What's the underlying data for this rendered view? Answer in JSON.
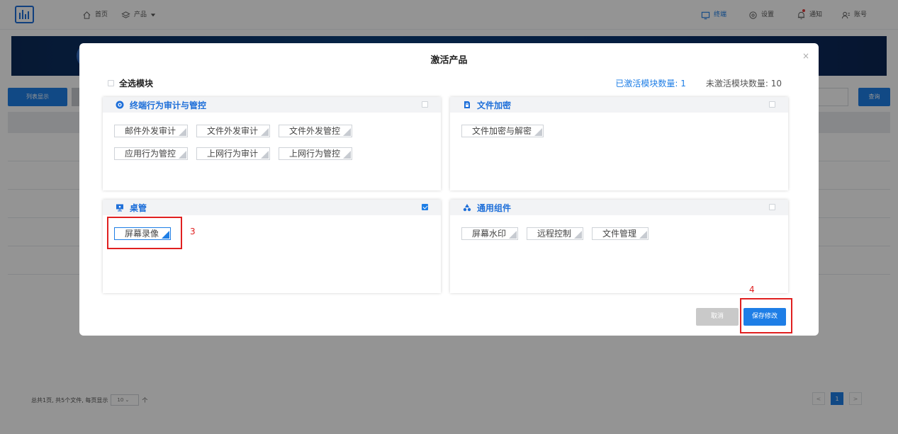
{
  "topbar": {
    "nav": [
      {
        "label": "首页",
        "icon": "home-icon"
      },
      {
        "label": "产品",
        "icon": "layers-icon"
      }
    ],
    "right": [
      {
        "label": "终端",
        "icon": "monitor-icon",
        "active": true
      },
      {
        "label": "设置",
        "icon": "settings-icon"
      },
      {
        "label": "通知",
        "icon": "bell-icon"
      },
      {
        "label": "账号",
        "icon": "user-icon"
      }
    ]
  },
  "background": {
    "list_button": "列表显示",
    "query_button": "查询",
    "pager": {
      "summary": "总共1页, 共5个文件, 每页显示",
      "page_size": "10",
      "unit": "个",
      "current_page": "1",
      "prev": "<",
      "next": ">"
    }
  },
  "modal": {
    "title": "激活产品",
    "close": "×",
    "select_all_label": "全选模块",
    "activated_count_label": "已激活模块数量: 1",
    "inactive_count_label": "未激活模块数量: 10",
    "panels": [
      {
        "title": "终端行为审计与管控",
        "icon": "gear-badge-icon",
        "checked": false,
        "modules": [
          "邮件外发审计",
          "文件外发审计",
          "文件外发管控",
          "应用行为管控",
          "上网行为审计",
          "上网行为管控"
        ]
      },
      {
        "title": "文件加密",
        "icon": "lock-file-icon",
        "checked": false,
        "modules": [
          "文件加密与解密"
        ]
      },
      {
        "title": "桌管",
        "icon": "desktop-icon",
        "checked": true,
        "modules": [
          "屏幕录像"
        ]
      },
      {
        "title": "通用组件",
        "icon": "recycle-icon",
        "checked": false,
        "modules": [
          "屏幕水印",
          "远程控制",
          "文件管理"
        ]
      }
    ],
    "cancel_label": "取消",
    "save_label": "保存修改"
  },
  "annotations": {
    "step3": "3",
    "step4": "4"
  },
  "colors": {
    "primary": "#1e7ee6",
    "highlight": "#e02020"
  }
}
